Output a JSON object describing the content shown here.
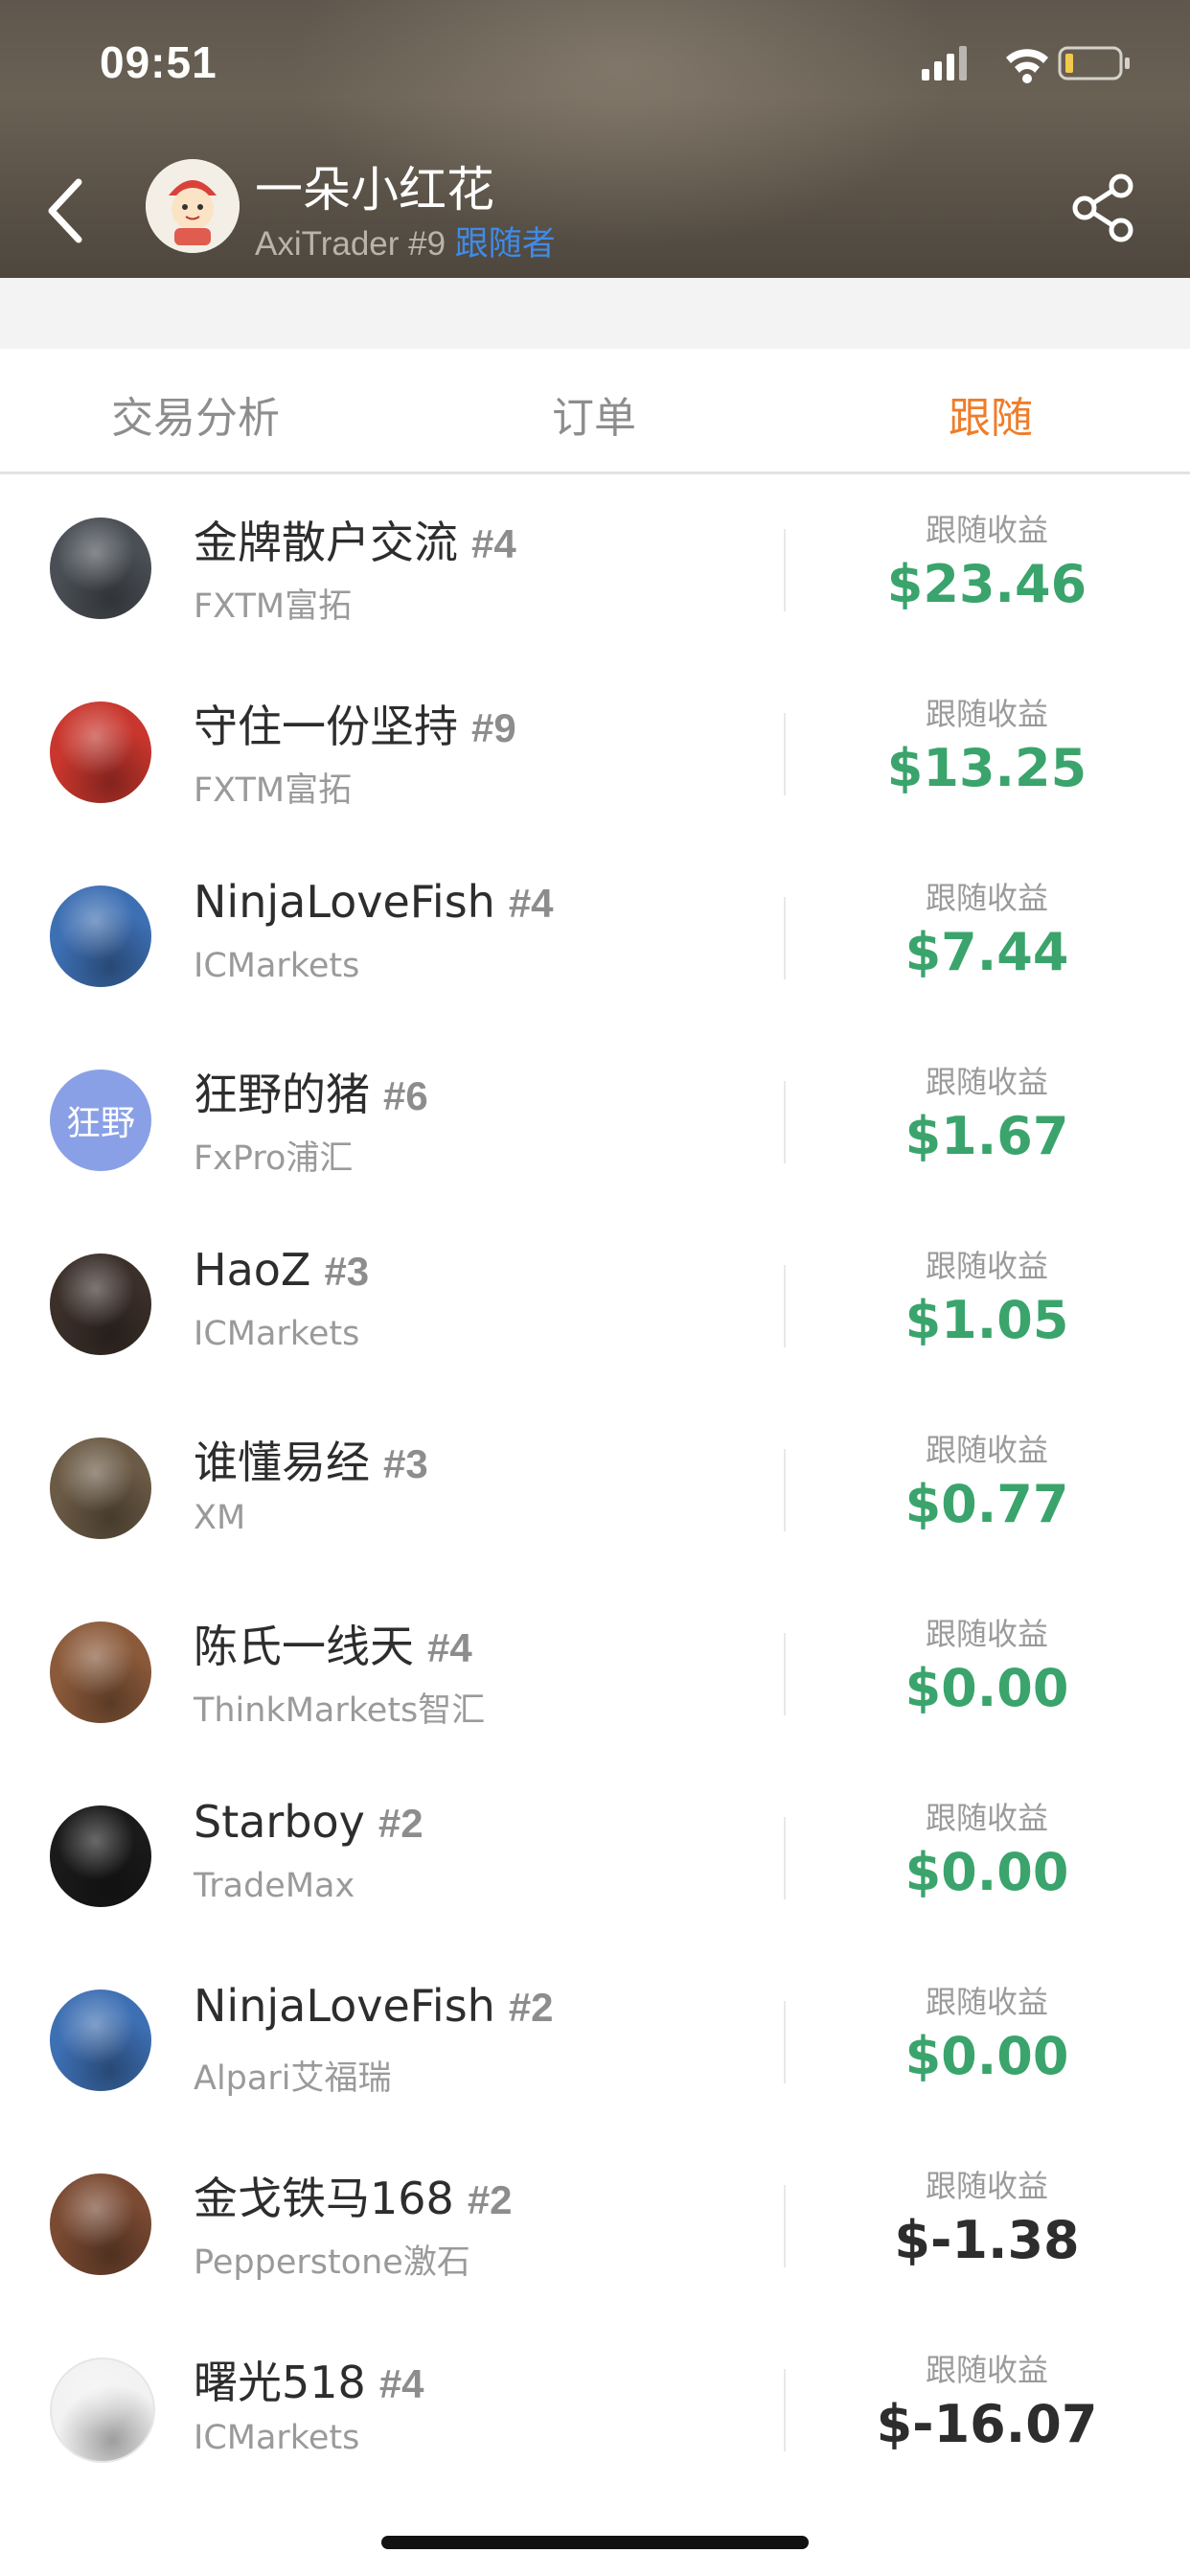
{
  "status": {
    "time": "09:51"
  },
  "header": {
    "name": "一朵小红花",
    "broker_rank": "AxiTrader #9",
    "role": "跟随者"
  },
  "tabs": [
    {
      "label": "交易分析"
    },
    {
      "label": "订单"
    },
    {
      "label": "跟随"
    }
  ],
  "followers": [
    {
      "name": "金牌散户交流",
      "rank": "#4",
      "broker": "FXTM富拓",
      "profit_label": "跟随收益",
      "profit": "$23.46",
      "profit_color": "#3aa46c",
      "avatar_color": "#4a4f55"
    },
    {
      "name": "守住一份坚持",
      "rank": "#9",
      "broker": "FXTM富拓",
      "profit_label": "跟随收益",
      "profit": "$13.25",
      "profit_color": "#3aa46c",
      "avatar_color": "#c8362d"
    },
    {
      "name": "NinjaLoveFish",
      "rank": "#4",
      "broker": "ICMarkets",
      "profit_label": "跟随收益",
      "profit": "$7.44",
      "profit_color": "#3aa46c",
      "avatar_color": "#3d6fb3"
    },
    {
      "name": "狂野的猪",
      "rank": "#6",
      "broker": "FxPro浦汇",
      "profit_label": "跟随收益",
      "profit": "$1.67",
      "profit_color": "#3aa46c",
      "avatar_color": "#8aa0e6",
      "avatar_text": "狂野"
    },
    {
      "name": "HaoZ",
      "rank": "#3",
      "broker": "ICMarkets",
      "profit_label": "跟随收益",
      "profit": "$1.05",
      "profit_color": "#3aa46c",
      "avatar_color": "#3b2f2a"
    },
    {
      "name": "谁懂易经",
      "rank": "#3",
      "broker": "XM",
      "profit_label": "跟随收益",
      "profit": "$0.77",
      "profit_color": "#3aa46c",
      "avatar_color": "#6b5a45"
    },
    {
      "name": "陈氏一线天",
      "rank": "#4",
      "broker": "ThinkMarkets智汇",
      "profit_label": "跟随收益",
      "profit": "$0.00",
      "profit_color": "#3aa46c",
      "avatar_color": "#8b5a3a"
    },
    {
      "name": "Starboy",
      "rank": "#2",
      "broker": "TradeMax",
      "profit_label": "跟随收益",
      "profit": "$0.00",
      "profit_color": "#3aa46c",
      "avatar_color": "#1a1a1a"
    },
    {
      "name": "NinjaLoveFish",
      "rank": "#2",
      "broker": "Alpari艾福瑞",
      "profit_label": "跟随收益",
      "profit": "$0.00",
      "profit_color": "#3aa46c",
      "avatar_color": "#3d6fb3"
    },
    {
      "name": "金戈铁马168",
      "rank": "#2",
      "broker": "Pepperstone激石",
      "profit_label": "跟随收益",
      "profit": "$-1.38",
      "profit_color": "#2d2d2d",
      "avatar_color": "#7a4a32"
    },
    {
      "name": "曙光518",
      "rank": "#4",
      "broker": "ICMarkets",
      "profit_label": "跟随收益",
      "profit": "$-16.07",
      "profit_color": "#2d2d2d",
      "avatar_color": "#f2f2f2"
    }
  ]
}
